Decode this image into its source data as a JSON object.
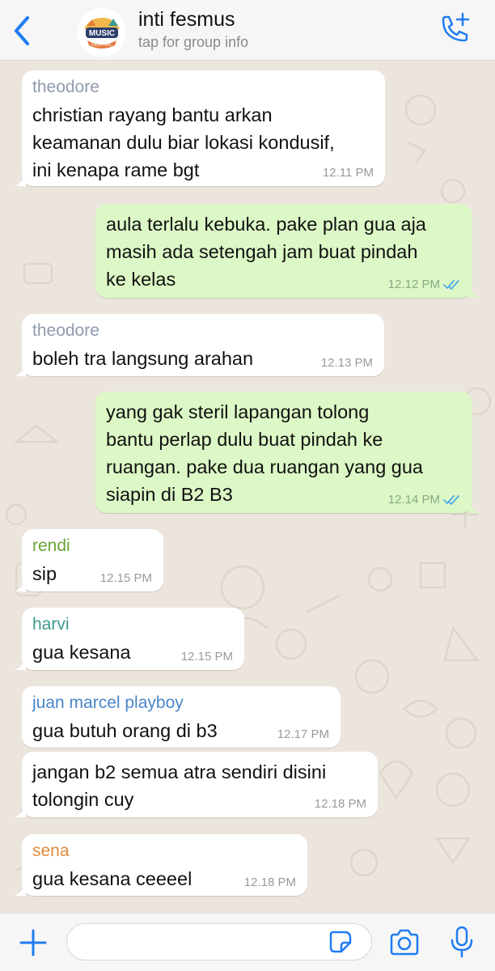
{
  "header": {
    "title": "inti fesmus",
    "subtitle": "tap for group info",
    "avatar_text_1": "MUSIC",
    "avatar_text_2": "FESTIVAL",
    "icons": [
      "back-arrow-icon",
      "group-avatar",
      "add-call-icon"
    ]
  },
  "colors": {
    "accent": "#1f7cf3",
    "outgoing_bubble": "#dcf8c6",
    "incoming_bubble": "#ffffff",
    "read_ticks": "#4fa8e8"
  },
  "messages": [
    {
      "direction": "in",
      "sender": "theodore",
      "sender_color": "#8e9aad",
      "text": "christian rayang bantu arkan\nkeamanan dulu biar lokasi kondusif,\nini kenapa rame bgt",
      "time": "12.11 PM"
    },
    {
      "direction": "out",
      "text": "aula terlalu kebuka. pake plan gua aja\nmasih ada setengah jam buat pindah\nke kelas",
      "time": "12.12 PM",
      "status": "read"
    },
    {
      "direction": "in",
      "sender": "theodore",
      "sender_color": "#8e9aad",
      "text": "boleh tra langsung arahan",
      "time": "12.13 PM"
    },
    {
      "direction": "out",
      "text": "yang gak steril lapangan tolong\nbantu perlap dulu buat pindah ke\nruangan. pake dua ruangan yang gua\nsiapin di B2 B3",
      "time": "12.14 PM",
      "status": "read"
    },
    {
      "direction": "in",
      "sender": "rendi",
      "sender_color": "#6aa33a",
      "text": "sip",
      "time": "12.15 PM"
    },
    {
      "direction": "in",
      "sender": "harvi",
      "sender_color": "#3f9a8e",
      "text": "gua kesana",
      "time": "12.15 PM"
    },
    {
      "direction": "in",
      "sender": "juan marcel playboy",
      "sender_color": "#4a86c8",
      "text": "gua butuh orang di b3",
      "time": "12.17 PM"
    },
    {
      "direction": "in",
      "text": "jangan b2 semua atra sendiri disini\ntolongin cuy",
      "time": "12.18 PM"
    },
    {
      "direction": "in",
      "sender": "sena",
      "sender_color": "#e08a3c",
      "text": "gua kesana ceeeel",
      "time": "12.18 PM"
    }
  ],
  "composer": {
    "value": "",
    "icons": [
      "plus-icon",
      "sticker-icon",
      "camera-icon",
      "microphone-icon"
    ]
  }
}
